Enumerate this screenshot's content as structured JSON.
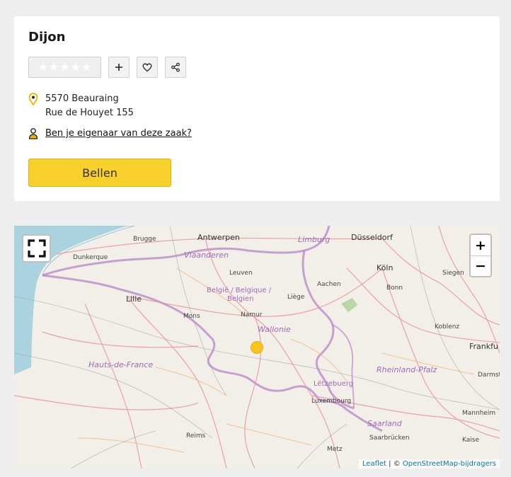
{
  "business": {
    "name": "Dijon",
    "address_line1": "5570 Beauraing",
    "address_line2": "Rue de Houyet 155",
    "owner_link": "Ben je eigenaar van deze zaak?",
    "call_label": "Bellen",
    "rating_stars": 0,
    "rating_max": 5
  },
  "icons": {
    "add": "plus-icon",
    "favorite": "heart-icon",
    "share": "share-icon",
    "location": "map-pin-icon",
    "owner": "person-icon",
    "fullscreen": "fullscreen-icon"
  },
  "colors": {
    "accent": "#f7d02c",
    "pin": "#f0b400",
    "map_marker": "#f7c51c",
    "border_lines": "#b98bc9"
  },
  "map": {
    "zoom_in": "+",
    "zoom_out": "−",
    "attribution": {
      "leaflet": "Leaflet",
      "separator": " | © ",
      "osm": "OpenStreetMap-bijdragers"
    },
    "labels": {
      "antwerpen": "Antwerpen",
      "dusseldorf": "Düsseldorf",
      "brugge": "Brugge",
      "dunkerque": "Dunkerque",
      "vlaanderen": "Vlaanderen",
      "limburg": "Limburg",
      "koln": "Köln",
      "siegen": "Siegen",
      "leuven": "Leuven",
      "aachen": "Aachen",
      "bonn": "Bonn",
      "lille": "Lille",
      "belgie": "België / Belgique /",
      "belgien": "Belgien",
      "liege": "Liège",
      "mons": "Mons",
      "namur": "Namur",
      "wallonie": "Wallonie",
      "koblenz": "Koblenz",
      "frankfurt": "Frankfu",
      "hauts": "Hauts-de-France",
      "rheinland": "Rheinland-Pfalz",
      "darmst": "Darmst",
      "letzebuerg": "Lëtzebuerg",
      "luxembourg": "Luxembourg",
      "mannheim": "Mannheim",
      "saarland": "Saarland",
      "reims": "Reims",
      "saarbrucken": "Saarbrücken",
      "metz": "Metz",
      "kaiser": "Kaise"
    }
  }
}
